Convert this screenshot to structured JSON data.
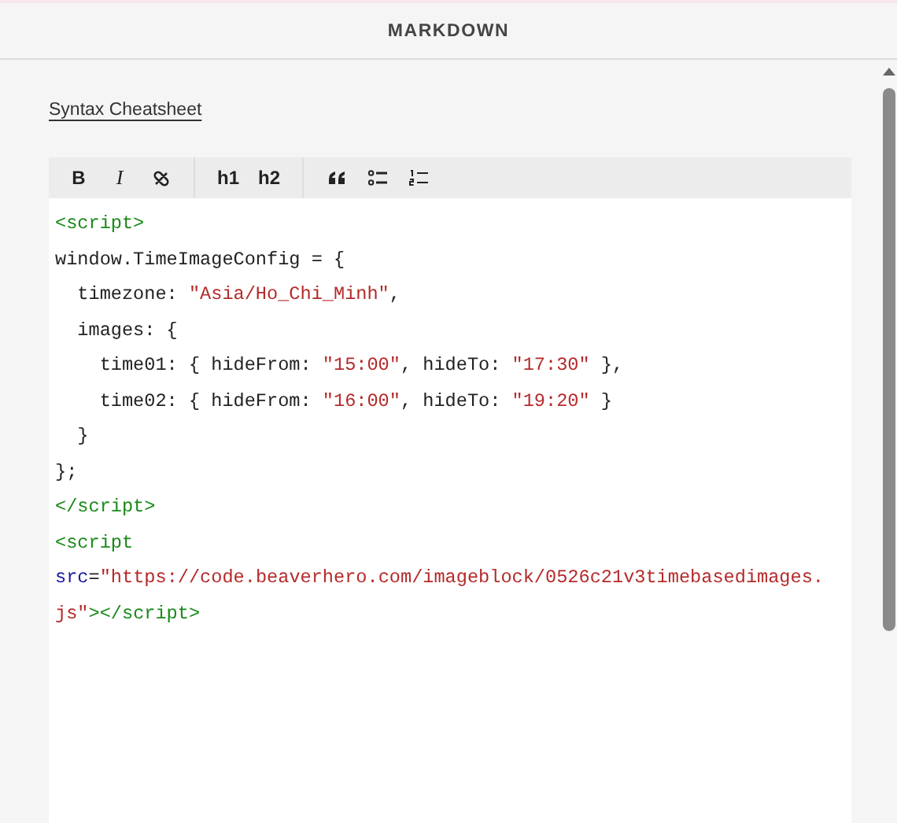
{
  "header": {
    "title": "MARKDOWN"
  },
  "link": "Syntax Cheatsheet",
  "toolbar": [
    {
      "kind": "bold",
      "label": "B"
    },
    {
      "kind": "italic",
      "label": "I"
    },
    {
      "kind": "link"
    },
    {
      "kind": "sep"
    },
    {
      "kind": "h",
      "label": "h1"
    },
    {
      "kind": "h",
      "label": "h2"
    },
    {
      "kind": "sep"
    },
    {
      "kind": "quote"
    },
    {
      "kind": "ul"
    },
    {
      "kind": "ol"
    }
  ],
  "code_lines": [
    [
      {
        "kind": "tag",
        "text": "<script>"
      }
    ],
    [
      {
        "kind": "plain",
        "text": "window.TimeImageConfig = {"
      }
    ],
    [
      {
        "kind": "plain",
        "text": "  timezone: "
      },
      {
        "kind": "string",
        "text": "\"Asia/Ho_Chi_Minh\""
      },
      {
        "kind": "plain",
        "text": ","
      }
    ],
    [
      {
        "kind": "plain",
        "text": "  images: {"
      }
    ],
    [
      {
        "kind": "plain",
        "text": "    time01: { hideFrom: "
      },
      {
        "kind": "string",
        "text": "\"15:00\""
      },
      {
        "kind": "plain",
        "text": ", hideTo: "
      },
      {
        "kind": "string",
        "text": "\"17:30\""
      },
      {
        "kind": "plain",
        "text": " },"
      }
    ],
    [
      {
        "kind": "plain",
        "text": "    time02: { hideFrom: "
      },
      {
        "kind": "string",
        "text": "\"16:00\""
      },
      {
        "kind": "plain",
        "text": ", hideTo: "
      },
      {
        "kind": "string",
        "text": "\"19:20\""
      },
      {
        "kind": "plain",
        "text": " }"
      }
    ],
    [
      {
        "kind": "plain",
        "text": "  }"
      }
    ],
    [
      {
        "kind": "plain",
        "text": "};"
      }
    ],
    [
      {
        "kind": "tag",
        "text": "</script>"
      }
    ],
    [
      {
        "kind": "tag",
        "text": "<script"
      }
    ],
    [
      {
        "kind": "attribute",
        "text": "src"
      },
      {
        "kind": "plain",
        "text": "="
      },
      {
        "kind": "string",
        "text": "\"https://code.beaverhero.com/imageblock/0526c21v3timebasedimages."
      }
    ],
    [
      {
        "kind": "string",
        "text": "js\""
      },
      {
        "kind": "tag",
        "text": "></script>"
      }
    ]
  ]
}
